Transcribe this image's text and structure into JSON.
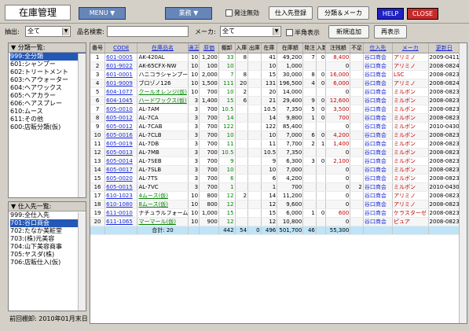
{
  "header": {
    "title": "在庫管理",
    "menu_label": "MENU ▼",
    "business_label": "業務 ▼",
    "flag_label": "発注無効",
    "register_label": "仕入先登録",
    "classify_label": "分類＆メーカ",
    "help_label": "HELP",
    "close_label": "CLOSE"
  },
  "filter": {
    "extract_label": "抽出:",
    "extract_value": "全て",
    "search_label": "品名検索:",
    "search_value": "",
    "maker_label": "メーカ:",
    "maker_value": "全て",
    "half_label": "半角表示",
    "new_label": "新規追加",
    "redisplay_label": "再表示"
  },
  "category_panel": {
    "title": "▼ 分類一覧:",
    "items": [
      "999:全分類",
      "601:シャンプー",
      "602:トリートメント",
      "603:ヘアウォーター",
      "604:ヘアワックス",
      "605:ヘアカラー",
      "606:ヘアスプレー",
      "610:ムース",
      "611:その他",
      "600:店販分類(仮)"
    ]
  },
  "supplier_panel": {
    "title": "▼ 仕入先一覧:",
    "items": [
      "999:全仕入先",
      "701:谷口商会",
      "702:たなか美粧堂",
      "703:(株)元美容",
      "704:山下美容商事",
      "705:ヤスダ(株)",
      "706:店販仕入(仮)"
    ]
  },
  "status": "前回棚卸: 2010年01月末日",
  "table": {
    "headers": [
      "番号",
      "CODE",
      "在庫品名",
      "適正",
      "原価",
      "棚卸",
      "入庫",
      "出庫",
      "在庫",
      "在庫額",
      "発注",
      "入数",
      "注残額",
      "不足",
      "仕入先",
      "メーカ",
      "更新日"
    ],
    "rows": [
      [
        "1",
        "601-0005",
        "AK-420AL",
        "10",
        "1,200",
        "33",
        "8",
        "",
        "41",
        "49,200",
        "7",
        "0",
        "8,400",
        "",
        "谷口商会",
        "アリミノ",
        "2009-0411"
      ],
      [
        "2",
        "601-9022",
        "AK-65CFX-NW",
        "10",
        "100",
        "10",
        "",
        "",
        "10",
        "1,000",
        "",
        "",
        "0",
        "",
        "谷口商会",
        "アリミノ",
        "2008-0824"
      ],
      [
        "3",
        "601-0001",
        "ハニコラシャンプー",
        "10",
        "2,000",
        "7",
        "8",
        "",
        "15",
        "30,000",
        "8",
        "0",
        "16,000",
        "",
        "谷口商会",
        "LSC",
        "2008-0823"
      ],
      [
        "4",
        "601-9009",
        "ブロゾノ126",
        "10",
        "1,500",
        "111",
        "20",
        "",
        "131",
        "196,500",
        "4",
        "0",
        "6,000",
        "",
        "谷口商会",
        "アリミノ",
        "2008-0824"
      ],
      [
        "5",
        "604-1077",
        "クールオレンジ(仮)",
        "10",
        "700",
        "10",
        "2",
        "",
        "20",
        "14,000",
        "",
        "",
        "0",
        "",
        "谷口商会",
        "ミルボン",
        "2008-0823"
      ],
      [
        "6",
        "604-1045",
        "ハードワックス(仮)",
        "3",
        "1,400",
        "15",
        "6",
        "",
        "21",
        "29,400",
        "9",
        "0",
        "12,600",
        "",
        "谷口商会",
        "ミルボン",
        "2008-0823"
      ],
      [
        "7",
        "605-0010",
        "AL-7AM",
        "3",
        "700",
        "10.5",
        "",
        "",
        "10.5",
        "7,350",
        "5",
        "0",
        "3,500",
        "",
        "谷口商会",
        "ミルボン",
        "2008-0823"
      ],
      [
        "8",
        "605-0012",
        "AL-7CA",
        "3",
        "700",
        "14",
        "",
        "",
        "14",
        "9,800",
        "1",
        "0",
        "700",
        "",
        "谷口商会",
        "ミルボン",
        "2008-0823"
      ],
      [
        "9",
        "605-0012",
        "AL-7CAB",
        "3",
        "700",
        "122",
        "",
        "",
        "122",
        "85,400",
        "",
        "",
        "0",
        "",
        "谷口商会",
        "ミルボン",
        "2010-0430"
      ],
      [
        "10",
        "605-0016",
        "AL-7CLB",
        "3",
        "700",
        "10",
        "",
        "",
        "10",
        "7,000",
        "6",
        "0",
        "4,200",
        "",
        "谷口商会",
        "ミルボン",
        "2008-0823"
      ],
      [
        "11",
        "605-0019",
        "AL-7DB",
        "3",
        "700",
        "11",
        "",
        "",
        "11",
        "7,700",
        "2",
        "1",
        "1,400",
        "",
        "谷口商会",
        "ミルボン",
        "2008-0823"
      ],
      [
        "12",
        "605-0013",
        "AL-7MB",
        "3",
        "700",
        "10.5",
        "",
        "",
        "10.5",
        "7,350",
        "",
        "",
        "0",
        "",
        "谷口商会",
        "ミルボン",
        "2008-0823"
      ],
      [
        "13",
        "605-0014",
        "AL-7SEB",
        "3",
        "700",
        "9",
        "",
        "",
        "9",
        "6,300",
        "3",
        "0",
        "2,100",
        "",
        "谷口商会",
        "ミルボン",
        "2008-0823"
      ],
      [
        "14",
        "605-0017",
        "AL-7SLB",
        "3",
        "700",
        "10",
        "",
        "",
        "10",
        "7,000",
        "",
        "",
        "0",
        "",
        "谷口商会",
        "ミルボン",
        "2008-0823"
      ],
      [
        "15",
        "605-0020",
        "AL-7TS",
        "3",
        "700",
        "6",
        "",
        "",
        "6",
        "4,200",
        "",
        "",
        "0",
        "",
        "谷口商会",
        "ミルボン",
        "2008-0823"
      ],
      [
        "16",
        "605-0015",
        "AL-7VC",
        "3",
        "700",
        "1",
        "",
        "",
        "1",
        "700",
        "",
        "",
        "0",
        "2",
        "谷口商会",
        "ミルボン",
        "2010-0430"
      ],
      [
        "17",
        "610-1023",
        "4ムース(仮)",
        "10",
        "800",
        "12",
        "2",
        "",
        "14",
        "11,200",
        "",
        "",
        "0",
        "",
        "谷口商会",
        "アリミノ",
        "2008-0823"
      ],
      [
        "18",
        "610-1080",
        "8ムース(仮)",
        "10",
        "800",
        "12",
        "",
        "",
        "12",
        "9,600",
        "",
        "",
        "0",
        "",
        "谷口商会",
        "アリミノ",
        "2008-0823"
      ],
      [
        "19",
        "611-0010",
        "ナチュラルフォーム",
        "10",
        "1,000",
        "15",
        "",
        "",
        "15",
        "6,000",
        "1",
        "0",
        "600",
        "",
        "谷口商会",
        "ケラスターゼ",
        "2008-0823"
      ],
      [
        "20",
        "611-1065",
        "マーマール(仮)",
        "10",
        "900",
        "12",
        "",
        "",
        "12",
        "10,800",
        "",
        "",
        "0",
        "",
        "谷口商会",
        "ピュア",
        "2008-0823"
      ]
    ],
    "total": {
      "label": "合計: 20",
      "tanaoroshi": "442",
      "nyuko": "54",
      "shukko": "0",
      "zaiko": "496",
      "zaikogaku": "501,700",
      "hacchu": "46",
      "chuzan": "55,300"
    }
  },
  "colors": {
    "accent": "#2357b8",
    "nav_button": "#6686b8",
    "help": "#1f22c4",
    "close": "#c62b2b",
    "total_row": "#bfe4f7"
  }
}
